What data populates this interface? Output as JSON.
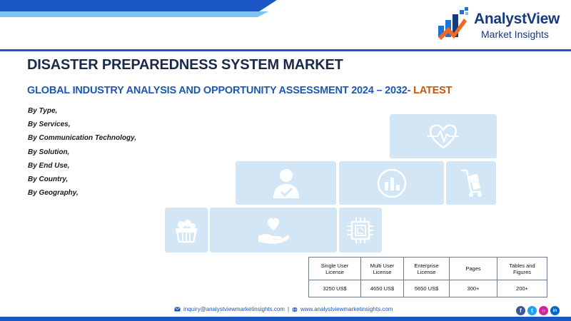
{
  "brand": {
    "name": "AnalystView",
    "tagline": "Market Insights"
  },
  "report": {
    "title": "DISASTER PREPAREDNESS SYSTEM MARKET",
    "subtitle_main": "GLOBAL INDUSTRY ANALYSIS AND OPPORTUNITY ASSESSMENT 2024 – 2032-",
    "subtitle_accent": "LATEST"
  },
  "segments": [
    "By Type,",
    "By Services,",
    "By Communication Technology,",
    "By Solution,",
    "By End Use,",
    "By Country,",
    "By Geography,"
  ],
  "license_table": {
    "headers": [
      [
        "Single User",
        "License"
      ],
      [
        "Multi User",
        "License"
      ],
      [
        "Enterprise",
        "License"
      ],
      [
        "Pages"
      ],
      [
        "Tables and",
        "Figures"
      ]
    ],
    "values": [
      "3250 US$",
      "4650 US$",
      "5650 US$",
      "300+",
      "200+"
    ]
  },
  "contact": {
    "email": "inquiry@analystviewmarketinsights.com",
    "separator": "|",
    "website": "www.analystviewmarketinsights.com"
  },
  "social": [
    {
      "icon": "facebook-icon",
      "glyph": "f",
      "color": "#3b5998"
    },
    {
      "icon": "twitter-icon",
      "glyph": "t",
      "color": "#1da1f2"
    },
    {
      "icon": "instagram-icon",
      "glyph": "○",
      "color": "#d6249f"
    },
    {
      "icon": "linkedin-icon",
      "glyph": "in",
      "color": "#0a66c2"
    }
  ],
  "colors": {
    "brand_blue": "#1a56c4",
    "brand_light_blue": "#7ec3f0",
    "accent_orange": "#c0560f",
    "tile_blue": "#d2e6f5"
  }
}
